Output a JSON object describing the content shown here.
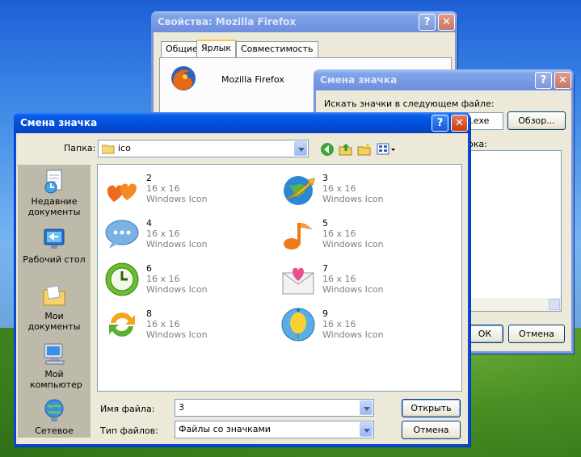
{
  "properties_window": {
    "title": "Свойства: Mozilla Firefox",
    "tabs": [
      "Общие",
      "Ярлык",
      "Совместимость"
    ],
    "active_tab": "Ярлык",
    "app_name": "Mozilla Firefox"
  },
  "change_icon_back": {
    "title": "Смена значка",
    "search_label": "Искать значки в следующем файле:",
    "file_value": "k.exe",
    "browse_label": "Обзор...",
    "list_label": "ока:",
    "ok_label": "ОК",
    "cancel_label": "Отмена"
  },
  "open_dialog": {
    "title": "Смена значка",
    "help_label": "?",
    "close_label": "✕",
    "folder_label": "Папка:",
    "folder_value": "ico",
    "places": [
      {
        "label": "Недавние документы",
        "icon": "recent-documents-icon"
      },
      {
        "label": "Рабочий стол",
        "icon": "desktop-icon"
      },
      {
        "label": "Мои документы",
        "icon": "my-documents-icon"
      },
      {
        "label": "Мой компьютер",
        "icon": "my-computer-icon"
      },
      {
        "label": "Сетевое",
        "icon": "network-icon"
      }
    ],
    "files": [
      {
        "name": "2",
        "size": "16 x 16",
        "type": "Windows Icon",
        "icon": "hearts-icon"
      },
      {
        "name": "3",
        "size": "16 x 16",
        "type": "Windows Icon",
        "icon": "globe-arrow-icon"
      },
      {
        "name": "4",
        "size": "16 x 16",
        "type": "Windows Icon",
        "icon": "chat-bubble-icon"
      },
      {
        "name": "5",
        "size": "16 x 16",
        "type": "Windows Icon",
        "icon": "music-note-icon"
      },
      {
        "name": "6",
        "size": "16 x 16",
        "type": "Windows Icon",
        "icon": "clock-icon"
      },
      {
        "name": "7",
        "size": "16 x 16",
        "type": "Windows Icon",
        "icon": "love-letter-icon"
      },
      {
        "name": "8",
        "size": "16 x 16",
        "type": "Windows Icon",
        "icon": "refresh-arrows-icon"
      },
      {
        "name": "9",
        "size": "16 x 16",
        "type": "Windows Icon",
        "icon": "balloon-icon"
      }
    ],
    "filename_label": "Имя файла:",
    "filename_value": "3",
    "filetype_label": "Тип файлов:",
    "filetype_value": "Файлы со значками",
    "open_label": "Открыть",
    "cancel_label": "Отмена"
  },
  "colors": {
    "xp_blue": "#0a46d8",
    "dialog_bg": "#ece9d8"
  }
}
